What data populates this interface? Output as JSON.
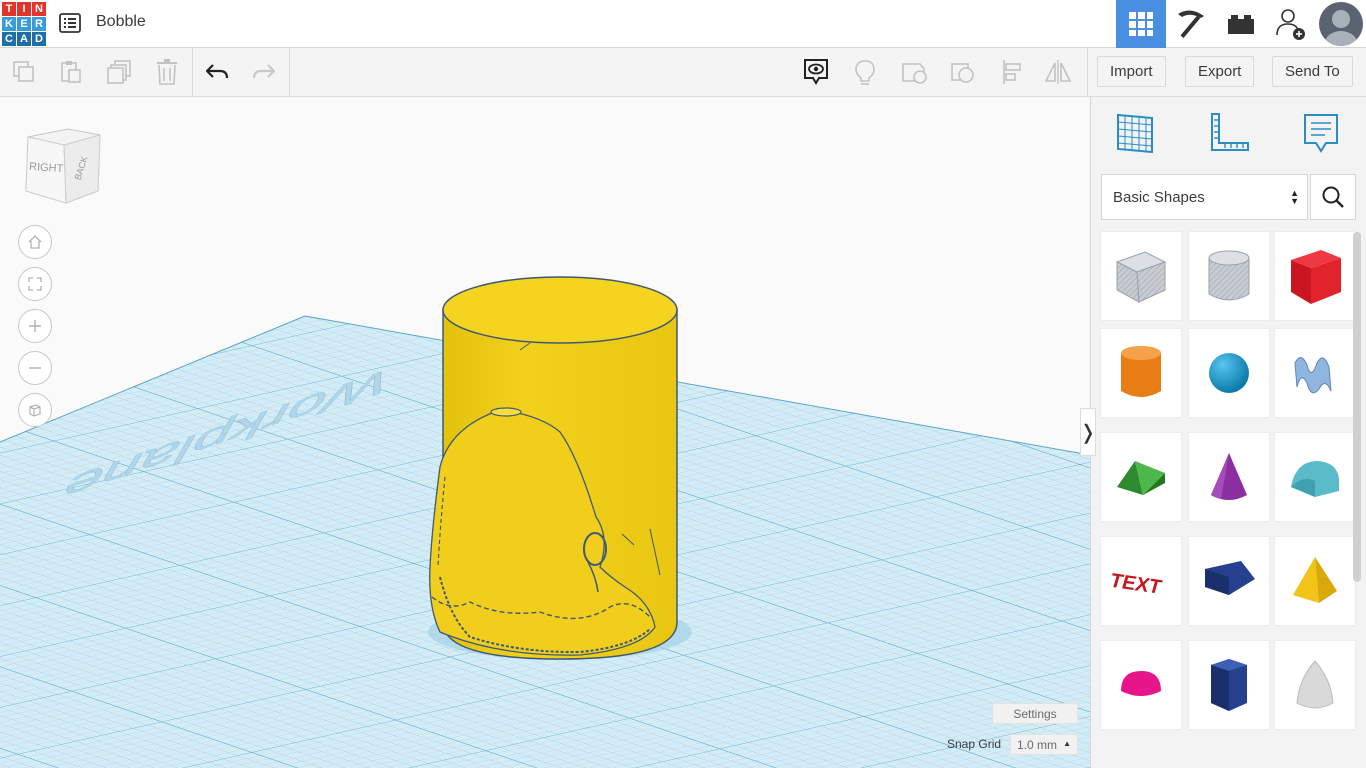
{
  "app": {
    "logo_letters": [
      "T",
      "I",
      "N",
      "K",
      "E",
      "R",
      "C",
      "A",
      "D"
    ],
    "logo_colors": [
      "#e6332a",
      "#e6332a",
      "#e6332a",
      "#3a9bd9",
      "#3a9bd9",
      "#3a9bd9",
      "#1d6fa5",
      "#1d6fa5",
      "#1d6fa5"
    ],
    "project_title": "Bobble"
  },
  "toolbar": {
    "import_label": "Import",
    "export_label": "Export",
    "send_to_label": "Send To"
  },
  "viewport": {
    "view_cube_right": "RIGHT",
    "view_cube_back": "BACK",
    "workplane_text": "Workplane",
    "settings_label": "Settings",
    "snap_grid_label": "Snap Grid",
    "snap_grid_value": "1.0 mm",
    "panel_toggle": "❭"
  },
  "sidebar": {
    "category": "Basic Shapes",
    "shapes": [
      {
        "name": "box-hole",
        "color": "#b8bcc4"
      },
      {
        "name": "cylinder-hole",
        "color": "#c4c7cc"
      },
      {
        "name": "box",
        "color": "#d81f2b"
      },
      {
        "name": "cylinder",
        "color": "#e87d15"
      },
      {
        "name": "sphere",
        "color": "#1a9fd4"
      },
      {
        "name": "scribble",
        "color": "#7fa9d6"
      },
      {
        "name": "roof",
        "color": "#3aa43a"
      },
      {
        "name": "cone",
        "color": "#8a2ea0"
      },
      {
        "name": "round-roof",
        "color": "#5bbcc9"
      },
      {
        "name": "text",
        "color": "#c4161c"
      },
      {
        "name": "wedge",
        "color": "#24408e"
      },
      {
        "name": "pyramid",
        "color": "#f2c418"
      },
      {
        "name": "half-sphere",
        "color": "#e6168a"
      },
      {
        "name": "polygon",
        "color": "#24408e"
      },
      {
        "name": "paraboloid",
        "color": "#d6d6d6"
      }
    ],
    "shape_text_label": "TEXT"
  }
}
